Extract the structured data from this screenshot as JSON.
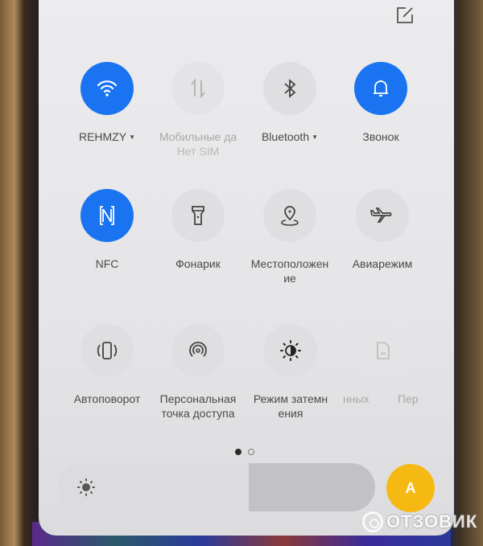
{
  "quick_settings": {
    "edit_icon": "edit-icon",
    "rows": [
      [
        {
          "label": "REHMZY",
          "has_dropdown": true,
          "state": "on",
          "icon": "wifi-icon"
        },
        {
          "label": "Мобильные да",
          "sublabel": "Нет SIM",
          "state": "disabled",
          "icon": "mobile-data-icon"
        },
        {
          "label": "Bluetooth",
          "has_dropdown": true,
          "state": "off",
          "icon": "bluetooth-icon"
        },
        {
          "label": "Звонок",
          "state": "on",
          "icon": "bell-icon"
        }
      ],
      [
        {
          "label": "NFC",
          "state": "on",
          "icon": "nfc-icon"
        },
        {
          "label": "Фонарик",
          "state": "off",
          "icon": "flashlight-icon"
        },
        {
          "label": "Местоположен",
          "label2": "ие",
          "state": "off",
          "icon": "location-icon"
        },
        {
          "label": "Авиарежим",
          "state": "off",
          "icon": "airplane-icon"
        }
      ],
      [
        {
          "label": "Автоповорот",
          "state": "off",
          "icon": "auto-rotate-icon"
        },
        {
          "label": "Персональная",
          "label2": "точка доступа",
          "state": "off",
          "icon": "hotspot-icon"
        },
        {
          "label": "Режим затемн",
          "label2": "ения",
          "state": "off",
          "icon": "dark-mode-icon"
        },
        {
          "label": "нных",
          "state": "disabled",
          "icon": "sim-icon"
        },
        {
          "label": "Пер",
          "state": "disabled"
        }
      ]
    ],
    "page_indicator": {
      "current": 1,
      "total": 2
    },
    "brightness": {
      "level_percent": 60,
      "icon": "brightness-icon"
    },
    "auto_brightness": {
      "label": "A",
      "color": "#f6b914"
    },
    "accent_color": "#1a73f0"
  },
  "watermark": {
    "text": "ОТЗОВИК"
  }
}
